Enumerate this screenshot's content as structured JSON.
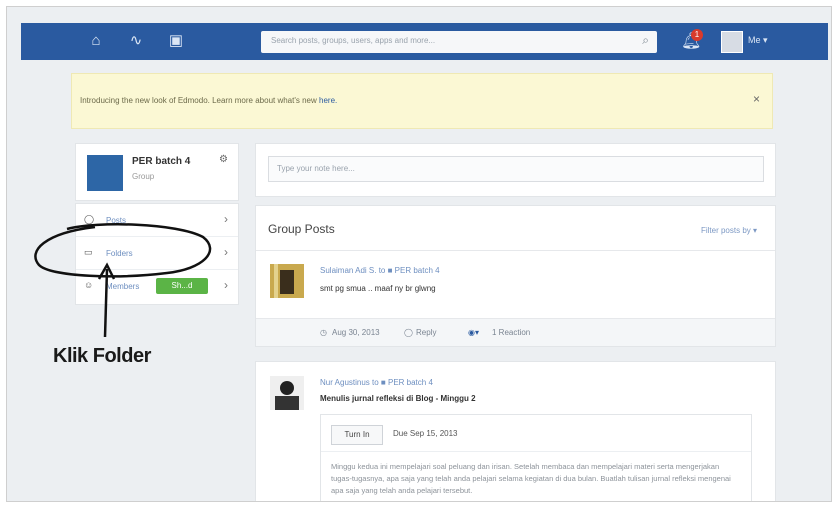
{
  "nav": {
    "search_placeholder": "Search posts, groups, users, apps and more...",
    "notification_count": "1",
    "me_label": "Me ▾"
  },
  "notice": {
    "text": "Introducing the new look of Edmodo. Learn more about what's new",
    "link": "here.",
    "close": "×"
  },
  "group": {
    "name": "PER batch 4",
    "type": "Group"
  },
  "sidebar": {
    "items": [
      {
        "label": "Posts"
      },
      {
        "label": "Folders"
      },
      {
        "label": "Members",
        "button": "Sh...d"
      }
    ]
  },
  "annotation": {
    "label": "Klik Folder"
  },
  "composer": {
    "placeholder": "Type your note here..."
  },
  "group_posts": {
    "title": "Group Posts",
    "filter": "Filter posts by ▾"
  },
  "posts": [
    {
      "author_line": "Sulaiman Adi S. to ■ PER batch 4",
      "text": "smt pg smua .. maaf ny br glwng",
      "date": "Aug 30, 2013",
      "reply": "Reply",
      "reactions": "1 Reaction"
    },
    {
      "author_line": "Nur Agustinus to ■ PER batch 4",
      "title": "Menulis jurnal refleksi di Blog - Minggu 2",
      "turn_in": "Turn In",
      "due": "Due Sep 15, 2013",
      "description": "Minggu kedua ini mempelajari soal peluang dan irisan. Setelah membaca dan mempelajari materi serta mengerjakan tugas-tugasnya, apa saja yang telah anda pelajari selama kegiatan di dua bulan. Buatlah tulisan jurnal refleksi mengenai apa saja yang telah anda pelajari tersebut."
    }
  ],
  "colors": {
    "nav": "#2a5aa0",
    "notice_bg": "#fbf8d4",
    "badge": "#d93a2b",
    "green_button": "#5bb446"
  }
}
